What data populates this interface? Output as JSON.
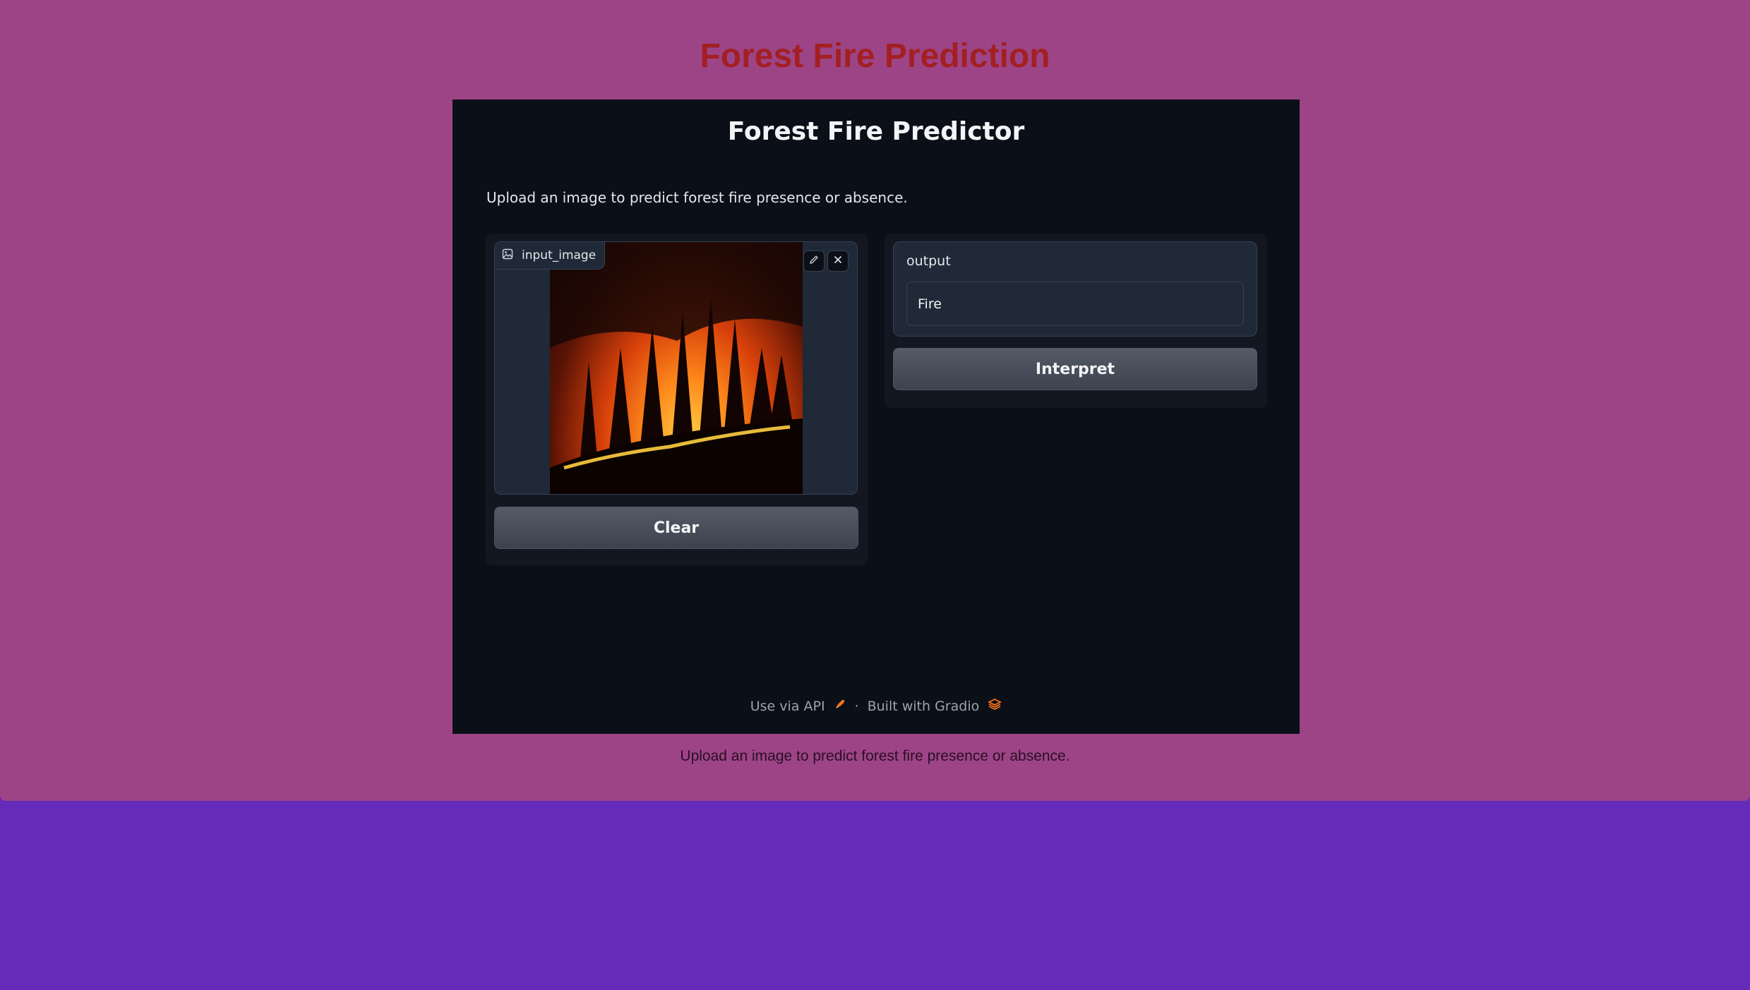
{
  "page": {
    "title": "Forest Fire Prediction",
    "description": "Upload an image to predict forest fire presence or absence."
  },
  "app": {
    "title": "Forest Fire Predictor",
    "description": "Upload an image to predict forest fire presence or absence.",
    "input": {
      "label": "input_image",
      "label_icon": "image-icon",
      "edit_icon": "pencil-icon",
      "close_icon": "close-icon"
    },
    "clear_label": "Clear",
    "output": {
      "label": "output",
      "value": "Fire"
    },
    "interpret_label": "Interpret",
    "footer": {
      "api_label": "Use via API",
      "separator": "·",
      "built_with": "Built with Gradio"
    }
  },
  "colors": {
    "page_bg": "#9d4487",
    "outer_bg": "#652bba",
    "title": "#a31f22",
    "app_bg": "#0b0f18"
  }
}
